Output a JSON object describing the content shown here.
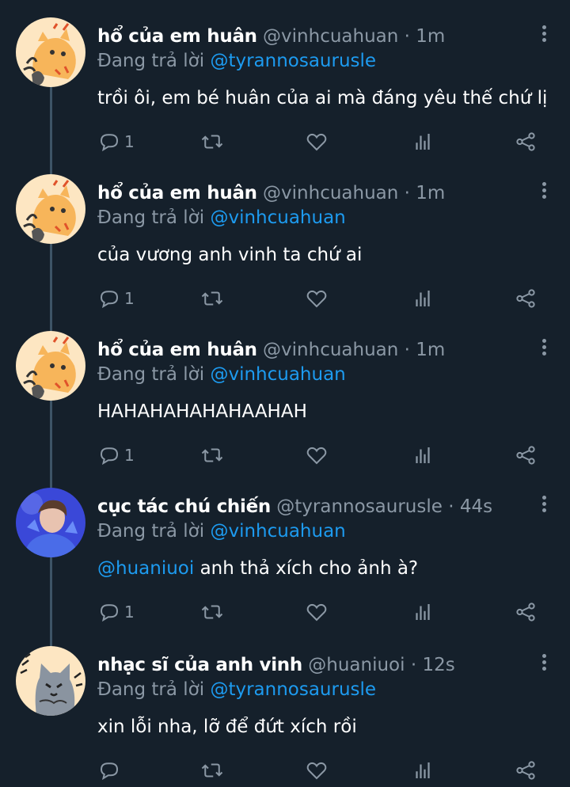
{
  "reply_prefix": "Đang trả lời",
  "colors": {
    "background": "#15202b",
    "link": "#1d9bf0",
    "muted": "#8b98a5",
    "thread_line": "#3d5466"
  },
  "tweets": [
    {
      "name": "hổ của em huân",
      "handle": "@vinhcuahuan",
      "dot": "·",
      "time": "1m",
      "reply_to": "@tyrannosaurusle",
      "text_mention": "",
      "text": "trồi ôi, em bé huân của ai mà đáng yêu thế chứ lị",
      "reply_count": "1",
      "avatar": "tiger-avatar"
    },
    {
      "name": "hổ của em huân",
      "handle": "@vinhcuahuan",
      "dot": "·",
      "time": "1m",
      "reply_to": "@vinhcuahuan",
      "text_mention": "",
      "text": "của vương anh vinh ta chứ ai",
      "reply_count": "1",
      "avatar": "tiger-avatar"
    },
    {
      "name": "hổ của em huân",
      "handle": "@vinhcuahuan",
      "dot": "·",
      "time": "1m",
      "reply_to": "@vinhcuahuan",
      "text_mention": "",
      "text": "HAHAHAHAHAHAAHAH",
      "reply_count": "1",
      "avatar": "tiger-avatar"
    },
    {
      "name": "cục tác chú chiến",
      "handle": "@tyrannosaurusle",
      "dot": "·",
      "time": "44s",
      "reply_to": "@vinhcuahuan",
      "text_mention": "@huaniuoi",
      "text": " anh thả xích cho ảnh à?",
      "reply_count": "1",
      "avatar": "photo-avatar"
    },
    {
      "name": "nhạc sĩ của anh vinh",
      "handle": "@huaniuoi",
      "dot": "·",
      "time": "12s",
      "reply_to": "@tyrannosaurusle",
      "text_mention": "",
      "text": "xin lỗi nha, lỡ để đứt xích rồi",
      "reply_count": "",
      "avatar": "cat-avatar"
    }
  ]
}
